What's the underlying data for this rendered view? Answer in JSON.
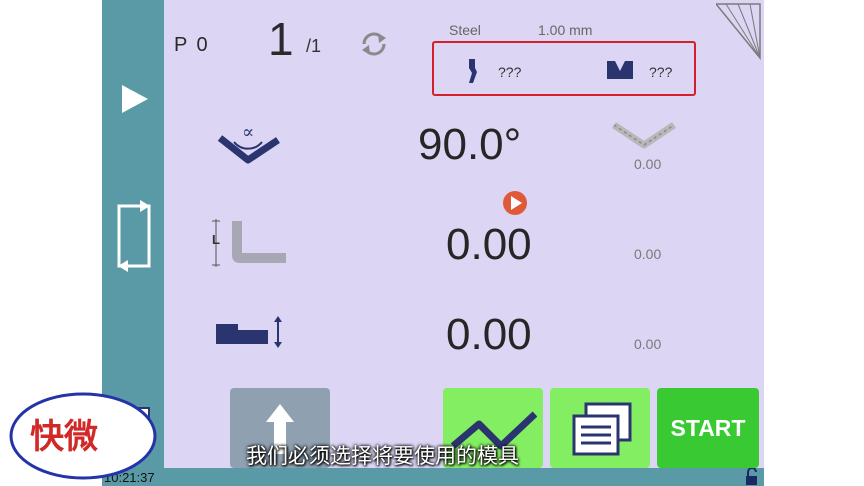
{
  "header": {
    "program": "P 0",
    "step": "1",
    "step_total": "/1",
    "material": "Steel",
    "thickness": "1.00 mm",
    "punch_value": "???",
    "die_value": "???"
  },
  "rows": {
    "angle": {
      "value": "90.0°",
      "aux": "0.00"
    },
    "backgauge": {
      "value": "0.00",
      "aux": "0.00"
    },
    "height": {
      "value": "0.00",
      "aux": "0.00"
    },
    "backgauge_label": "L"
  },
  "buttons": {
    "start": "START"
  },
  "status": {
    "time": "10:21:37"
  },
  "subtitle": "我们必须选择将要使用的模具",
  "logo_text": "快微",
  "colors": {
    "panel": "#dcd5f3",
    "sidebar": "#5a9aa6",
    "start": "#39c933",
    "green": "#84ee62",
    "highlight": "#d4202a",
    "icon": "#2a3570"
  },
  "icons": [
    "play-icon",
    "page-frame-icon",
    "document-icon",
    "refresh-icon",
    "punch-icon",
    "die-icon",
    "bend-angle-icon",
    "crowning-icon",
    "backgauge-icon",
    "height-adjust-icon",
    "arrow-up-icon",
    "bend-graph-icon",
    "program-list-icon",
    "unlock-icon"
  ]
}
